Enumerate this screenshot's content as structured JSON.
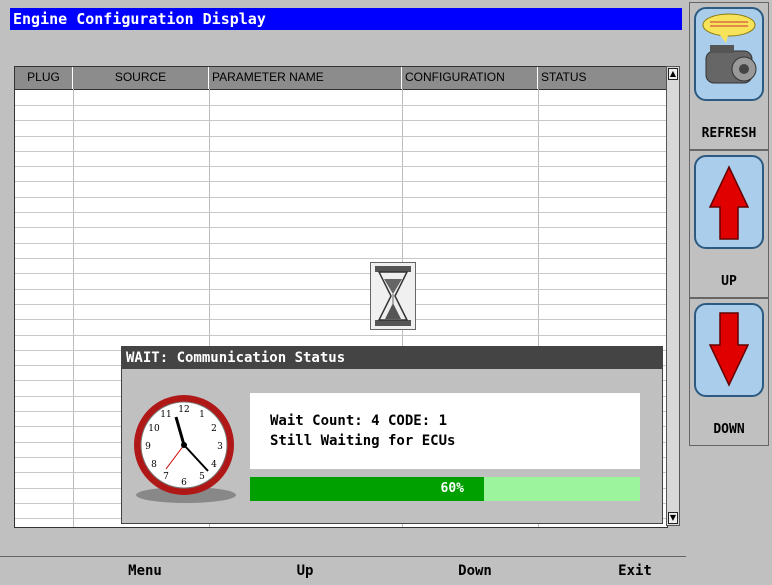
{
  "window": {
    "title": "Engine Configuration Display"
  },
  "table": {
    "columns": [
      "PLUG",
      "SOURCE",
      "PARAMETER NAME",
      "CONFIGURATION",
      "STATUS"
    ],
    "rows": []
  },
  "dialog": {
    "title": "WAIT: Communication Status",
    "line1": "Wait Count: 4 CODE: 1",
    "line2": "Still Waiting for ECUs",
    "progress_text": "60%",
    "progress_value": 0.6
  },
  "function_keys": [
    "Menu",
    "Up",
    "Down",
    "Exit"
  ],
  "side_buttons": {
    "refresh": "REFRESH",
    "up": "UP",
    "down": "DOWN"
  },
  "colors": {
    "title_bar": "#0000ff",
    "progress_fill": "#00a000",
    "progress_track": "#9cf59c",
    "arrow": "#e00000"
  }
}
